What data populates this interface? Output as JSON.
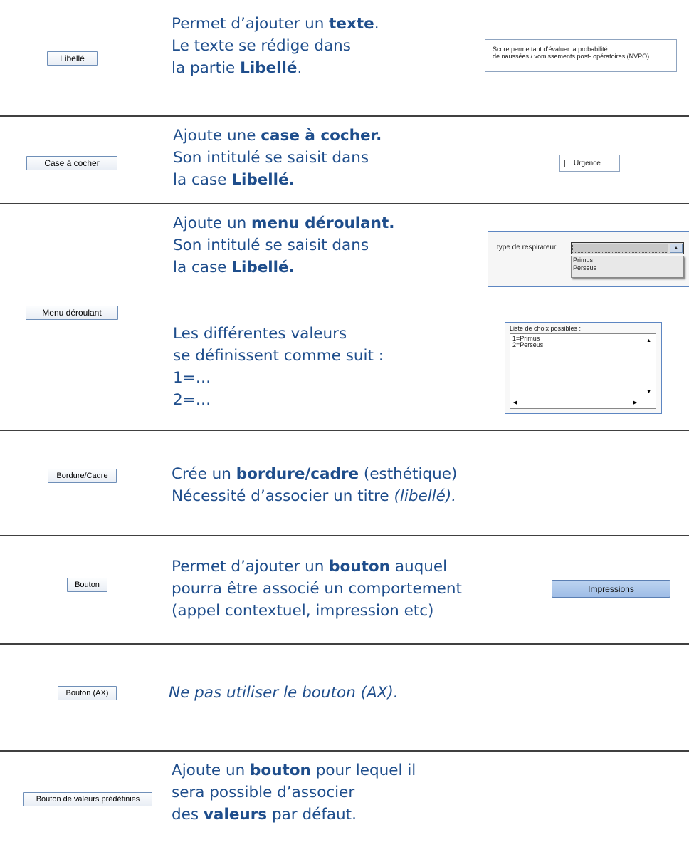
{
  "sections": [
    {
      "tool_label": "Libellé",
      "lines": [
        {
          "parts": [
            {
              "t": "Permet d’ajouter un "
            },
            {
              "t": "texte",
              "b": true
            },
            {
              "t": "."
            }
          ]
        },
        {
          "parts": [
            {
              "t": "Le texte se rédige dans"
            }
          ]
        },
        {
          "parts": [
            {
              "t": "la partie "
            },
            {
              "t": "Libellé",
              "b": true
            },
            {
              "t": "."
            }
          ]
        }
      ]
    },
    {
      "tool_label": "Case à cocher",
      "lines": [
        {
          "parts": [
            {
              "t": "Ajoute une "
            },
            {
              "t": "case à cocher.",
              "b": true
            }
          ]
        },
        {
          "parts": [
            {
              "t": "Son intitulé se saisit dans"
            }
          ]
        },
        {
          "parts": [
            {
              "t": "la case "
            },
            {
              "t": "Libellé.",
              "b": true
            }
          ]
        }
      ]
    },
    {
      "tool_label": "Menu déroulant",
      "lines": [
        {
          "parts": [
            {
              "t": "Ajoute un "
            },
            {
              "t": "menu déroulant.",
              "b": true
            }
          ]
        },
        {
          "parts": [
            {
              "t": "Son intitulé se saisit dans"
            }
          ]
        },
        {
          "parts": [
            {
              "t": "la case "
            },
            {
              "t": "Libellé.",
              "b": true
            }
          ]
        }
      ],
      "lines2": [
        {
          "parts": [
            {
              "t": "Les différentes valeurs"
            }
          ]
        },
        {
          "parts": [
            {
              "t": "se définissent comme suit :"
            }
          ]
        },
        {
          "parts": [
            {
              "t": "1=…"
            }
          ]
        },
        {
          "parts": [
            {
              "t": "2=…"
            }
          ]
        }
      ]
    },
    {
      "tool_label": "Bordure/Cadre",
      "lines": [
        {
          "parts": [
            {
              "t": "Crée un "
            },
            {
              "t": "bordure/cadre",
              "b": true
            },
            {
              "t": " (esthétique)"
            }
          ]
        },
        {
          "parts": [
            {
              "t": "Nécessité d’associer un titre "
            },
            {
              "t": "(libellé).",
              "i": true
            }
          ]
        }
      ]
    },
    {
      "tool_label": "Bouton",
      "lines": [
        {
          "parts": [
            {
              "t": "Permet d’ajouter un "
            },
            {
              "t": "bouton",
              "b": true
            },
            {
              "t": " auquel"
            }
          ]
        },
        {
          "parts": [
            {
              "t": "pourra être associé un comportement"
            }
          ]
        },
        {
          "parts": [
            {
              "t": "(appel contextuel, impression etc)"
            }
          ]
        }
      ]
    },
    {
      "tool_label": "Bouton (AX)",
      "lines": [
        {
          "parts": [
            {
              "t": "Ne pas utiliser le bouton (AX).",
              "i": true
            }
          ]
        }
      ]
    },
    {
      "tool_label": "Bouton de valeurs prédéfinies",
      "lines": [
        {
          "parts": [
            {
              "t": "Ajoute un "
            },
            {
              "t": "bouton",
              "b": true
            },
            {
              "t": " pour lequel il"
            }
          ]
        },
        {
          "parts": [
            {
              "t": "sera possible d’associer"
            }
          ]
        },
        {
          "parts": [
            {
              "t": "des "
            },
            {
              "t": "valeurs",
              "b": true
            },
            {
              "t": " par défaut."
            }
          ]
        }
      ]
    }
  ],
  "previews": {
    "label_text_line1": "Score permettant d’évaluer la probabilité",
    "label_text_line2": "de naussées / vomissements post- opératoires (NVPO)",
    "checkbox_label": "Urgence",
    "dropdown_label": "type de respirateur",
    "dropdown_options": [
      "Primus",
      "Perseus"
    ],
    "choices_title": "Liste de choix possibles :",
    "choices_values": [
      "1=Primus",
      "2=Perseus"
    ],
    "button_label": "Impressions"
  }
}
